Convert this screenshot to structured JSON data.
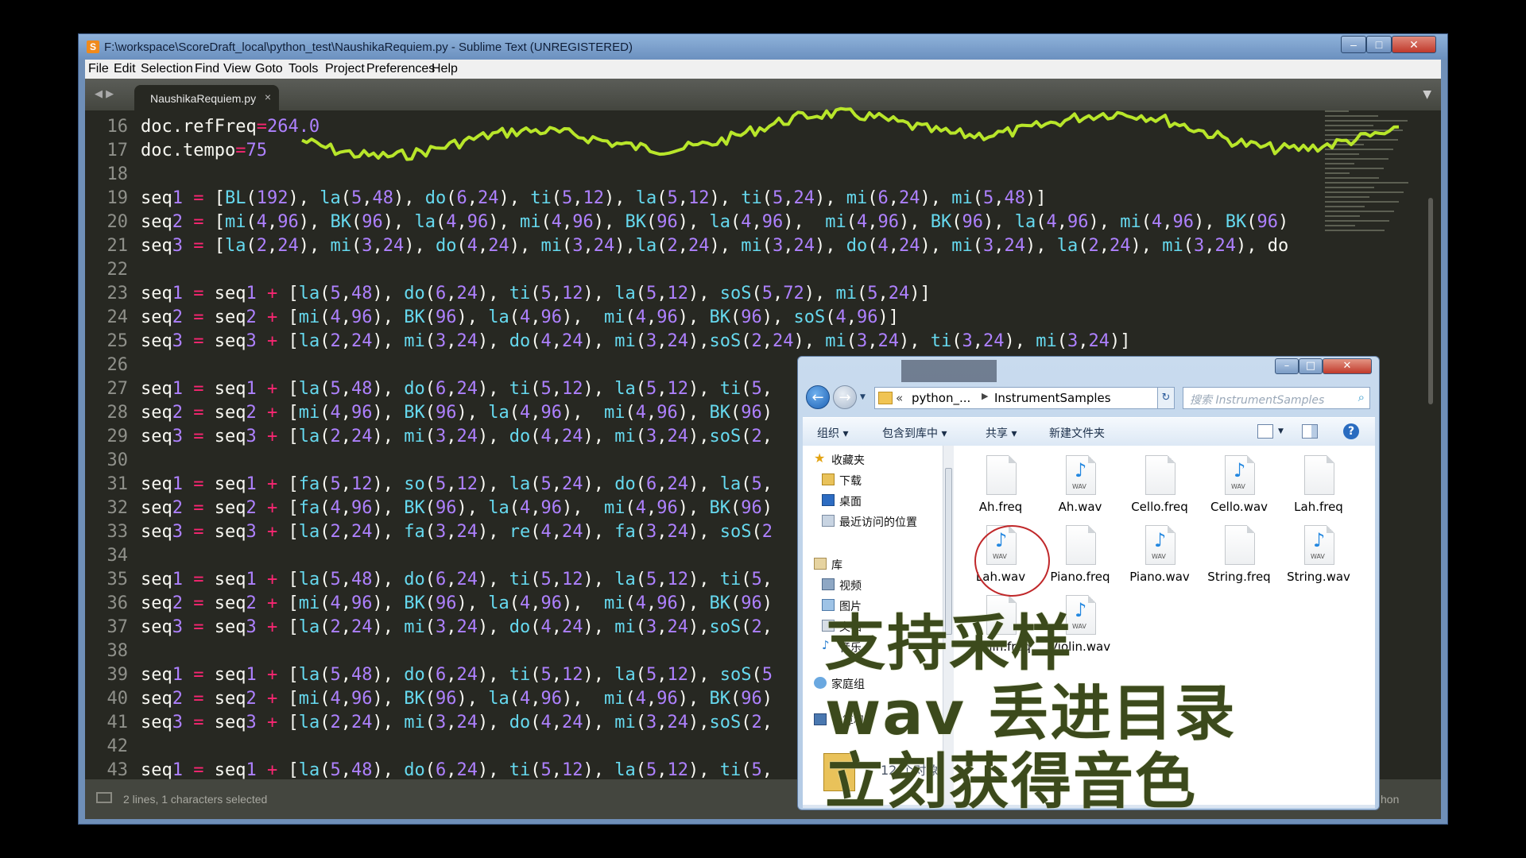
{
  "sublime": {
    "title": "F:\\workspace\\ScoreDraft_local\\python_test\\NaushikaRequiem.py - Sublime Text (UNREGISTERED)",
    "menu": [
      "File",
      "Edit",
      "Selection",
      "Find",
      "View",
      "Goto",
      "Tools",
      "Project",
      "Preferences",
      "Help"
    ],
    "tab": {
      "label": "NaushikaRequiem.py",
      "close": "×"
    },
    "status": {
      "text": "2 lines, 1 characters selected",
      "syntax": "hon"
    },
    "window_controls": {
      "min": "–",
      "max": "□",
      "close": "✕"
    }
  },
  "code": {
    "lines": [
      {
        "n": "16",
        "t": "doc.refFreq=264.0"
      },
      {
        "n": "17",
        "t": "doc.tempo=75"
      },
      {
        "n": "18",
        "t": ""
      },
      {
        "n": "19",
        "t": "seq1 = [BL(192), la(5,48), do(6,24), ti(5,12), la(5,12), ti(5,24), mi(6,24), mi(5,48)]"
      },
      {
        "n": "20",
        "t": "seq2 = [mi(4,96), BK(96), la(4,96), mi(4,96), BK(96), la(4,96),  mi(4,96), BK(96), la(4,96), mi(4,96), BK(96)"
      },
      {
        "n": "21",
        "t": "seq3 = [la(2,24), mi(3,24), do(4,24), mi(3,24),la(2,24), mi(3,24), do(4,24), mi(3,24), la(2,24), mi(3,24), do"
      },
      {
        "n": "22",
        "t": ""
      },
      {
        "n": "23",
        "t": "seq1 = seq1 + [la(5,48), do(6,24), ti(5,12), la(5,12), soS(5,72), mi(5,24)]"
      },
      {
        "n": "24",
        "t": "seq2 = seq2 + [mi(4,96), BK(96), la(4,96),  mi(4,96), BK(96), soS(4,96)]"
      },
      {
        "n": "25",
        "t": "seq3 = seq3 + [la(2,24), mi(3,24), do(4,24), mi(3,24),soS(2,24), mi(3,24), ti(3,24), mi(3,24)]"
      },
      {
        "n": "26",
        "t": ""
      },
      {
        "n": "27",
        "t": "seq1 = seq1 + [la(5,48), do(6,24), ti(5,12), la(5,12), ti(5,"
      },
      {
        "n": "28",
        "t": "seq2 = seq2 + [mi(4,96), BK(96), la(4,96),  mi(4,96), BK(96)"
      },
      {
        "n": "29",
        "t": "seq3 = seq3 + [la(2,24), mi(3,24), do(4,24), mi(3,24),soS(2,"
      },
      {
        "n": "30",
        "t": ""
      },
      {
        "n": "31",
        "t": "seq1 = seq1 + [fa(5,12), so(5,12), la(5,24), do(6,24), la(5,"
      },
      {
        "n": "32",
        "t": "seq2 = seq2 + [fa(4,96), BK(96), la(4,96),  mi(4,96), BK(96)"
      },
      {
        "n": "33",
        "t": "seq3 = seq3 + [la(2,24), fa(3,24), re(4,24), fa(3,24), soS(2"
      },
      {
        "n": "34",
        "t": ""
      },
      {
        "n": "35",
        "t": "seq1 = seq1 + [la(5,48), do(6,24), ti(5,12), la(5,12), ti(5,"
      },
      {
        "n": "36",
        "t": "seq2 = seq2 + [mi(4,96), BK(96), la(4,96),  mi(4,96), BK(96)"
      },
      {
        "n": "37",
        "t": "seq3 = seq3 + [la(2,24), mi(3,24), do(4,24), mi(3,24),soS(2,"
      },
      {
        "n": "38",
        "t": ""
      },
      {
        "n": "39",
        "t": "seq1 = seq1 + [la(5,48), do(6,24), ti(5,12), la(5,12), soS(5"
      },
      {
        "n": "40",
        "t": "seq2 = seq2 + [mi(4,96), BK(96), la(4,96),  mi(4,96), BK(96)"
      },
      {
        "n": "41",
        "t": "seq3 = seq3 + [la(2,24), mi(3,24), do(4,24), mi(3,24),soS(2,"
      },
      {
        "n": "42",
        "t": ""
      },
      {
        "n": "43",
        "t": "seq1 = seq1 + [la(5,48), do(6,24), ti(5,12), la(5,12), ti(5,"
      }
    ],
    "colors": {
      "background": "#272822",
      "text": "#f8f8f2",
      "operator": "#f92672",
      "number": "#ae81ff",
      "function": "#66d9ef",
      "waveform": "#b8e62a"
    }
  },
  "explorer": {
    "breadcrumb_prefix": "«",
    "breadcrumb": [
      "python_...",
      "InstrumentSamples"
    ],
    "search_placeholder": "搜索 InstrumentSamples",
    "toolbar": {
      "organize": "组织 ▾",
      "include_library": "包含到库中 ▾",
      "share": "共享 ▾",
      "new_folder": "新建文件夹"
    },
    "nav": [
      {
        "label": "收藏夹",
        "icon": "star-icon"
      },
      {
        "label": "下载",
        "icon": "download-folder-icon"
      },
      {
        "label": "桌面",
        "icon": "desktop-icon"
      },
      {
        "label": "最近访问的位置",
        "icon": "recent-places-icon"
      },
      {
        "label": "库",
        "icon": "library-icon"
      },
      {
        "label": "视频",
        "icon": "video-library-icon"
      },
      {
        "label": "图片",
        "icon": "pictures-library-icon"
      },
      {
        "label": "文档",
        "icon": "documents-library-icon"
      },
      {
        "label": "音乐",
        "icon": "music-library-icon"
      },
      {
        "label": "家庭组",
        "icon": "homegroup-icon"
      },
      {
        "label": "计算机",
        "icon": "computer-icon"
      }
    ],
    "files": [
      {
        "name": "Ah.freq",
        "type": "freq"
      },
      {
        "name": "Ah.wav",
        "type": "wav"
      },
      {
        "name": "Cello.freq",
        "type": "freq"
      },
      {
        "name": "Cello.wav",
        "type": "wav"
      },
      {
        "name": "Lah.freq",
        "type": "freq"
      },
      {
        "name": "Lah.wav",
        "type": "wav"
      },
      {
        "name": "Piano.freq",
        "type": "freq"
      },
      {
        "name": "Piano.wav",
        "type": "wav"
      },
      {
        "name": "String.freq",
        "type": "freq"
      },
      {
        "name": "String.wav",
        "type": "wav"
      },
      {
        "name": "Violin.freq",
        "type": "freq"
      },
      {
        "name": "Violin.wav",
        "type": "wav"
      }
    ],
    "wav_tag": "WAV",
    "status_count": "12 个对象"
  },
  "caption": {
    "line1": "支持采样",
    "line2": "wav 丢进目录",
    "line3": "立刻获得音色"
  }
}
